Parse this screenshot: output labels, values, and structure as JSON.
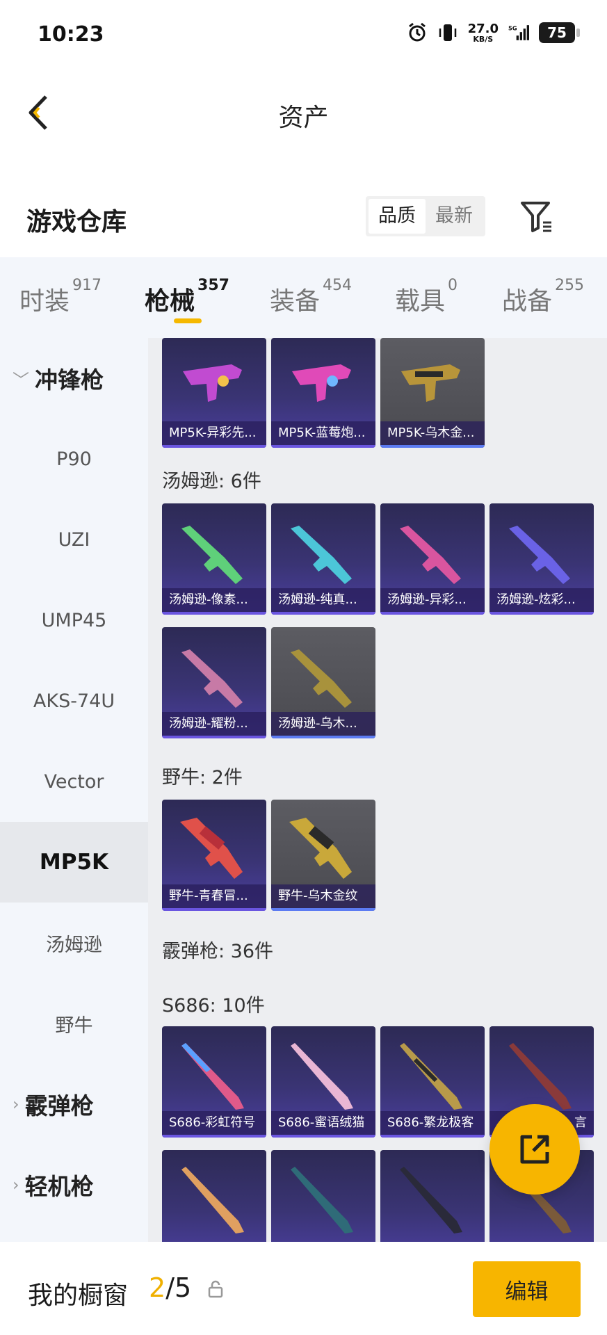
{
  "status_bar": {
    "time": "10:23",
    "net_speed": "27.0",
    "net_unit": "KB/S",
    "battery": "75"
  },
  "header": {
    "title": "资产"
  },
  "warehouse": {
    "title": "游戏仓库",
    "sort_options": [
      "品质",
      "最新"
    ],
    "active_sort": "品质"
  },
  "category_tabs": [
    {
      "label": "时装",
      "count": "917"
    },
    {
      "label": "枪械",
      "count": "357",
      "active": true
    },
    {
      "label": "装备",
      "count": "454"
    },
    {
      "label": "载具",
      "count": "0"
    },
    {
      "label": "战备",
      "count": "255"
    }
  ],
  "sidebar": {
    "items": [
      {
        "label": "冲锋枪",
        "type": "group-open"
      },
      {
        "label": "P90"
      },
      {
        "label": "UZI"
      },
      {
        "label": "UMP45"
      },
      {
        "label": "AKS-74U"
      },
      {
        "label": "Vector"
      },
      {
        "label": "MP5K",
        "selected": true
      },
      {
        "label": "汤姆逊"
      },
      {
        "label": "野牛"
      },
      {
        "label": "霰弹枪",
        "type": "group-closed"
      },
      {
        "label": "轻机枪",
        "type": "group-closed"
      }
    ]
  },
  "sections": [
    {
      "title": "",
      "items": [
        "MP5K-异彩先...",
        "MP5K-蓝莓炮...",
        "MP5K-乌木金..."
      ]
    },
    {
      "title": "汤姆逊: 6件",
      "items": [
        "汤姆逊-像素...",
        "汤姆逊-纯真...",
        "汤姆逊-异彩...",
        "汤姆逊-炫彩...",
        "汤姆逊-耀粉...",
        "汤姆逊-乌木..."
      ]
    },
    {
      "title": "野牛: 2件",
      "items": [
        "野牛-青春冒...",
        "野牛-乌木金纹"
      ]
    },
    {
      "title": "霰弹枪: 36件",
      "items": []
    },
    {
      "title": "S686: 10件",
      "items": [
        "S686-彩虹符号",
        "S686-蜜语绒猫",
        "S686-繁龙极客",
        "言"
      ]
    }
  ],
  "bottom_bar": {
    "title": "我的橱窗",
    "current": "2",
    "total": "/5",
    "edit_label": "编辑"
  },
  "colors": {
    "accent": "#f7b500",
    "card_purple": "#3a3474",
    "card_gray": "#4a4a50"
  }
}
